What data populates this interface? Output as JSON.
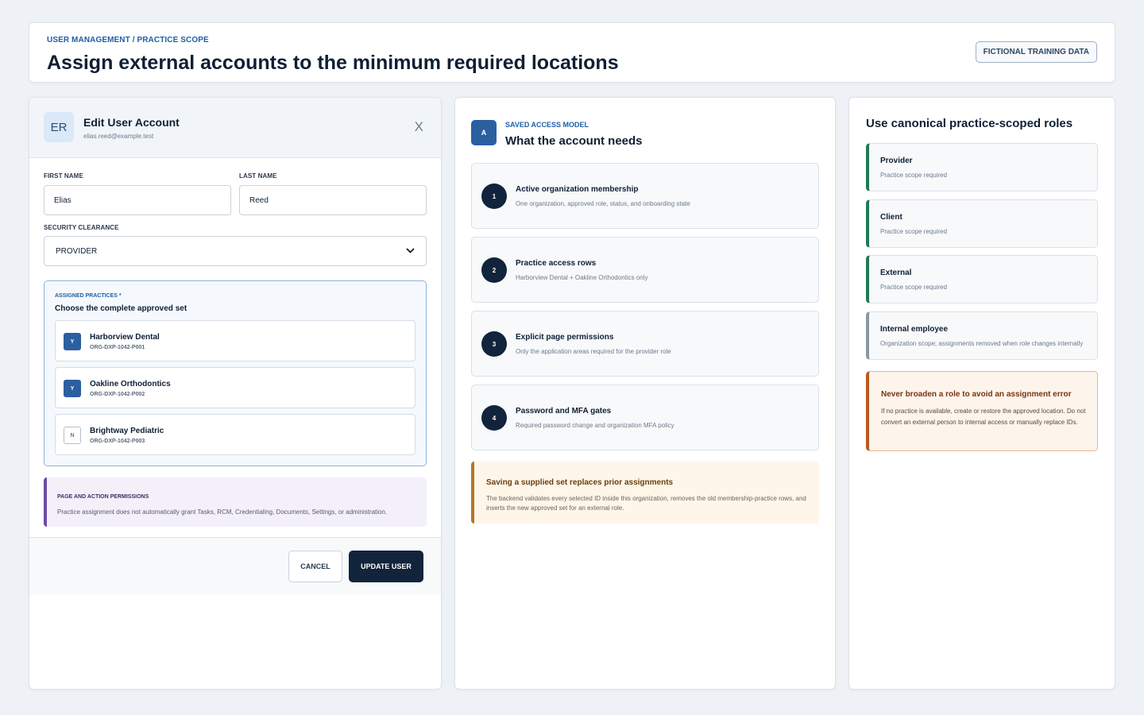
{
  "header": {
    "breadcrumb": "USER MANAGEMENT / PRACTICE SCOPE",
    "title": "Assign external accounts to the minimum required locations",
    "badge": "FICTIONAL TRAINING DATA"
  },
  "edit_panel": {
    "avatar_initials": "ER",
    "title": "Edit User Account",
    "email": "elias.reed@example.test",
    "close_label": "X",
    "first_name": {
      "label": "FIRST NAME",
      "value": "Elias"
    },
    "last_name": {
      "label": "LAST NAME",
      "value": "Reed"
    },
    "clearance": {
      "label": "SECURITY CLEARANCE",
      "value": "PROVIDER"
    },
    "practices": {
      "label": "ASSIGNED PRACTICES *",
      "title": "Choose the complete approved set",
      "items": [
        {
          "mark": "Y",
          "name": "Harborview Dental",
          "id": "ORG-DXP-1042-P001",
          "checked": true
        },
        {
          "mark": "Y",
          "name": "Oakline Orthodontics",
          "id": "ORG-DXP-1042-P002",
          "checked": true
        },
        {
          "mark": "N",
          "name": "Brightway Pediatric",
          "id": "ORG-DXP-1042-P003",
          "checked": false
        }
      ]
    },
    "permissions_note": {
      "label": "PAGE AND ACTION PERMISSIONS",
      "text": "Practice assignment does not automatically grant Tasks, RCM, Credentialing, Documents, Settings, or administration."
    },
    "cancel_label": "CANCEL",
    "update_label": "UPDATE USER"
  },
  "access_model": {
    "icon_letter": "A",
    "label": "SAVED ACCESS MODEL",
    "title": "What the account needs",
    "steps": [
      {
        "num": "1",
        "title": "Active organization membership",
        "sub": "One organization, approved role, status, and onboarding state"
      },
      {
        "num": "2",
        "title": "Practice access rows",
        "sub": "Harborview Dental + Oakline Orthodontics only"
      },
      {
        "num": "3",
        "title": "Explicit page permissions",
        "sub": "Only the application areas required for the provider role"
      },
      {
        "num": "4",
        "title": "Password and MFA gates",
        "sub": "Required password change and organization MFA policy"
      }
    ],
    "warning": {
      "title": "Saving a supplied set replaces prior assignments",
      "text": "The backend validates every selected ID inside this organization, removes the old membership-practice rows, and inserts the new approved set for an external role."
    }
  },
  "roles_panel": {
    "title": "Use canonical practice-scoped roles",
    "roles": [
      {
        "name": "Provider",
        "sub": "Practice scope required",
        "accent": "#1f7a55"
      },
      {
        "name": "Client",
        "sub": "Practice scope required",
        "accent": "#1f7a55"
      },
      {
        "name": "External",
        "sub": "Practice scope required",
        "accent": "#1f7a55"
      },
      {
        "name": "Internal employee",
        "sub": "Organization scope; assignments removed when role changes internally",
        "accent": "#8a96a3"
      }
    ],
    "warning": {
      "title": "Never broaden a role to avoid an assignment error",
      "text": "If no practice is available, create or restore the approved location. Do not convert an external person to internal access or manually replace IDs."
    }
  }
}
